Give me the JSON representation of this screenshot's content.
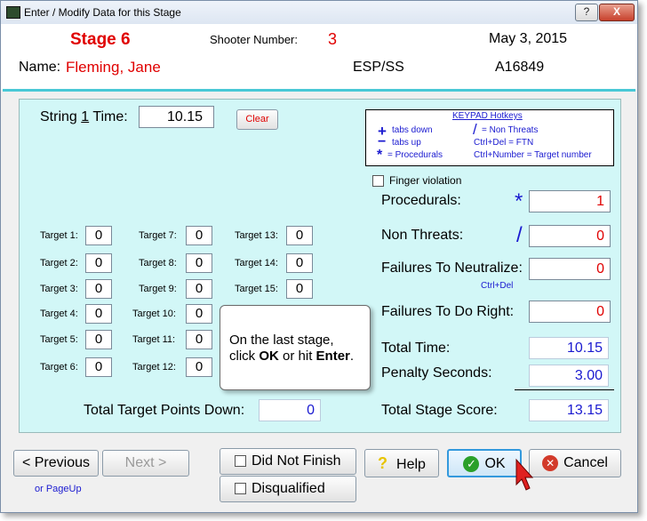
{
  "window": {
    "title": "Enter / Modify Data for this Stage",
    "help_btn": "?",
    "close_btn": "X"
  },
  "header": {
    "stage": "Stage  6",
    "shooter_label": "Shooter Number:",
    "shooter_number": "3",
    "date": "May  3, 2015",
    "name_label": "Name:",
    "name": "Fleming, Jane",
    "division": "ESP/SS",
    "member_id": "A16849"
  },
  "string": {
    "label_pre": "String ",
    "label_num": "1",
    "label_post": " Time:",
    "value": "10.15",
    "clear_label": "Clear"
  },
  "hotkeys": {
    "title": "KEYPAD Hotkeys",
    "rows": [
      {
        "sym1": "+",
        "desc1": "tabs down",
        "sym2": "/",
        "desc2": "= Non Threats"
      },
      {
        "sym1": "−",
        "desc1": "tabs up",
        "sym2": "",
        "desc2": "Ctrl+Del = FTN"
      },
      {
        "sym1": "*",
        "desc1": "= Procedurals",
        "sym2": "",
        "desc2": "Ctrl+Number = Target number"
      }
    ]
  },
  "finger_violation": "Finger violation",
  "targets": [
    {
      "label": "Target 1:",
      "value": "0"
    },
    {
      "label": "Target 2:",
      "value": "0"
    },
    {
      "label": "Target 3:",
      "value": "0"
    },
    {
      "label": "Target 4:",
      "value": "0"
    },
    {
      "label": "Target 5:",
      "value": "0"
    },
    {
      "label": "Target 6:",
      "value": "0"
    },
    {
      "label": "Target 7:",
      "value": "0"
    },
    {
      "label": "Target 8:",
      "value": "0"
    },
    {
      "label": "Target 9:",
      "value": "0"
    },
    {
      "label": "Target 10:",
      "value": "0"
    },
    {
      "label": "Target 11:",
      "value": "0"
    },
    {
      "label": "Target 12:",
      "value": "0"
    },
    {
      "label": "Target 13:",
      "value": "0"
    },
    {
      "label": "Target 14:",
      "value": "0"
    },
    {
      "label": "Target 15:",
      "value": "0"
    }
  ],
  "penalties": {
    "procedurals_label": "Procedurals:",
    "procedurals_sym": "*",
    "procedurals": "1",
    "non_threats_label": "Non Threats:",
    "non_threats_sym": "/",
    "non_threats": "0",
    "ftn_label": "Failures To Neutralize:",
    "ftn_hint": "Ctrl+Del",
    "ftn": "0",
    "ftdr_label": "Failures To Do Right:",
    "ftdr": "0"
  },
  "totals": {
    "total_time_label": "Total Time:",
    "total_time": "10.15",
    "penalty_label": "Penalty Seconds:",
    "penalty": "3.00",
    "score_label": "Total Stage Score:",
    "score": "13.15",
    "points_down_label": "Total Target Points Down:",
    "points_down": "0"
  },
  "tooltip": {
    "line1": "On the last stage,",
    "line2_a": "click ",
    "line2_ok": "OK",
    "line2_b": " or hit ",
    "line2_enter": "Enter",
    "line2_end": "."
  },
  "buttons": {
    "previous": "< Previous",
    "previous_hint": "or PageUp",
    "next": "Next >",
    "dnf": "Did Not Finish",
    "dq": "Disqualified",
    "help": "Help",
    "ok": "OK",
    "cancel": "Cancel"
  }
}
